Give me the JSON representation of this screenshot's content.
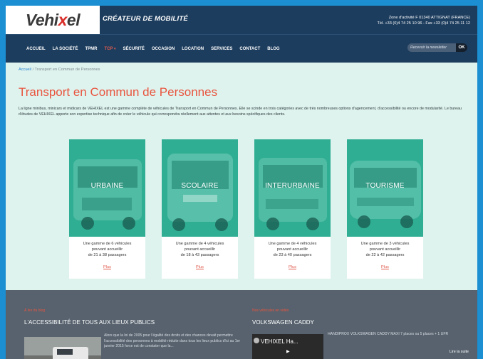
{
  "header": {
    "logo_prefix": "Vehi",
    "logo_x": "x",
    "logo_suffix": "el",
    "tagline": "CRÉATEUR DE MOBILITÉ",
    "address": "Zone d'activité F 01340 ATTIGNAT (FRANCE)",
    "phone": "Tél. +33 (0)4 74 25 10 96 - Fax +33 (0)4 74 25 11 12"
  },
  "nav": {
    "items": [
      {
        "label": "ACCUEIL"
      },
      {
        "label": "LA SOCIÉTÉ"
      },
      {
        "label": "TPMR"
      },
      {
        "label": "TCP"
      },
      {
        "label": "SÉCURITÉ"
      },
      {
        "label": "OCCASION"
      },
      {
        "label": "LOCATION"
      },
      {
        "label": "SERVICES"
      },
      {
        "label": "CONTACT"
      },
      {
        "label": "BLOG"
      }
    ],
    "active_index": 3,
    "newsletter_placeholder": "Recevoir la newsletter",
    "newsletter_ok": "OK"
  },
  "breadcrumb": {
    "home": "Accueil",
    "separator": "/",
    "current": "Transport en Commun de Personnes"
  },
  "page": {
    "title": "Transport en Commun de Personnes",
    "intro": "La ligne minibus, minicars et midicars de VEHIXEL est une gamme complète de véhicules de Transport en Commun de Personnes. Elle se scinde en trois catégories avec de très nombreuses options d'agencement, d'accessibilité ou encore de modularité. Le bureau d'études de VEHIXEL apporte son expertise technique afin de créer le véhicule qui correspondra réellement aux attentes et aux besoins spécifiques des clients."
  },
  "cards": [
    {
      "category": "URBAINE",
      "line1": "Une gamme de 6 véhicules",
      "line2": "pouvant accueillir",
      "line3": "de 21 à 38 passagers",
      "more": "Plus"
    },
    {
      "category": "SCOLAIRE",
      "line1": "Une gamme de 4 véhicules",
      "line2": "pouvant accueillir",
      "line3": "de 18 à 43 passagers",
      "more": "Plus"
    },
    {
      "category": "INTERURBAINE",
      "line1": "Une gamme de 4 véhicules",
      "line2": "pouvant accueillir",
      "line3": "de 23 à 40 passagers",
      "more": "Plus"
    },
    {
      "category": "TOURISME",
      "line1": "Une gamme de 3 véhicules",
      "line2": "pouvant accueillir",
      "line3": "de 22 à 42 passagers",
      "more": "Plus"
    }
  ],
  "blog": {
    "kicker": "À lire du blog",
    "title": "L'ACCESSIBILITÉ DE TOUS AUX LIEUX PUBLICS",
    "excerpt": "Alors que la loi de 2005 pour l'égalité des droits et des chances devait permettre l'accessibilité des personnes à mobilité réduite dans tous les lieux publics d'ici au 1er janvier 2015 force est de constater que la..."
  },
  "video": {
    "kicker": "Nos véhicules en vidéo",
    "title": "VOLKSWAGEN CADDY",
    "player_title": "VEHIXEL Ha...",
    "caption": "HANDIPROX VOLKSWAGEN CADDY MAXI 7 places ou 5 places + 1 UFR",
    "read_more": "Lire la suite"
  },
  "colors": {
    "accent": "#e8553f",
    "navy": "#1d3d5e",
    "teal": "#2fae93",
    "page_bg": "#dff3ee",
    "footer": "#57626e"
  }
}
